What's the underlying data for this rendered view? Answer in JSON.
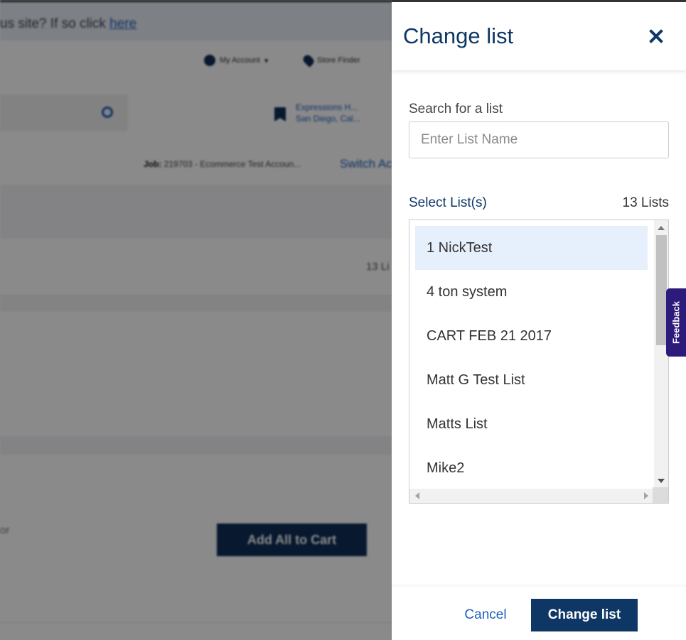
{
  "background": {
    "banner_text": "us site? If so click ",
    "banner_link": "here",
    "my_account": "My Account",
    "store_finder": "Store Finder",
    "store_name_line1": "Expressions H...",
    "store_name_line2": "San Diego, Cal...",
    "job_label": "Job:",
    "job_value": "219703 - Ecommerce Test Accoun...",
    "switch_account": "Switch Ac",
    "list_count": "13 Li",
    "or_text": "or",
    "add_all_to_cart": "Add All to Cart"
  },
  "drawer": {
    "title": "Change list",
    "close_icon": "close-icon",
    "search_label": "Search for a list",
    "search_placeholder": "Enter List Name",
    "search_value": "",
    "select_label": "Select List(s)",
    "list_count": "13 Lists",
    "lists": [
      {
        "name": "1 NickTest",
        "selected": true
      },
      {
        "name": "4 ton system",
        "selected": false
      },
      {
        "name": "CART FEB 21 2017",
        "selected": false
      },
      {
        "name": "Matt G Test List",
        "selected": false
      },
      {
        "name": "Matts List",
        "selected": false
      },
      {
        "name": "Mike2",
        "selected": false
      }
    ],
    "cancel_label": "Cancel",
    "change_label": "Change list"
  },
  "feedback": {
    "label": "Feedback"
  },
  "colors": {
    "primary": "#0e3766",
    "link": "#1d5fbd",
    "selected_row": "#e6effc",
    "feedback": "#2c1b7a"
  }
}
